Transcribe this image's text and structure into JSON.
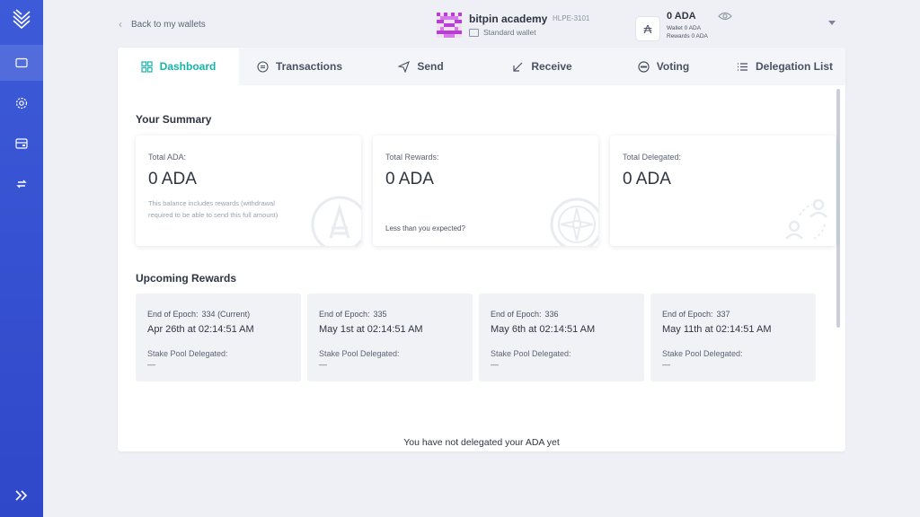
{
  "sidebar": {
    "items": [
      {
        "icon": "wallet-icon",
        "active": true
      },
      {
        "icon": "gear-icon",
        "active": false
      },
      {
        "icon": "hardware-wallet-icon",
        "active": false
      },
      {
        "icon": "exchange-icon",
        "active": false
      }
    ],
    "expand_icon": "double-chevron-right-icon"
  },
  "header": {
    "back_label": "Back to my wallets",
    "wallet_name": "bitpin academy",
    "wallet_ticker": "HLPE-3101",
    "wallet_type": "Standard wallet",
    "balance": "0 ADA",
    "wallet_line": "Wallet 0 ADA",
    "rewards_line": "Rewards 0 ADA"
  },
  "tabs": [
    {
      "label": "Dashboard",
      "icon": "dashboard-icon",
      "active": true
    },
    {
      "label": "Transactions",
      "icon": "transactions-icon",
      "active": false
    },
    {
      "label": "Send",
      "icon": "send-icon",
      "active": false
    },
    {
      "label": "Receive",
      "icon": "receive-icon",
      "active": false
    },
    {
      "label": "Voting",
      "icon": "voting-icon",
      "active": false
    },
    {
      "label": "Delegation List",
      "icon": "list-icon",
      "active": false
    }
  ],
  "summary": {
    "title": "Your Summary",
    "cards": [
      {
        "label": "Total ADA:",
        "value": "0 ADA",
        "note": "This balance includes rewards (withdrawal required to be able to send this full amount)"
      },
      {
        "label": "Total Rewards:",
        "value": "0 ADA",
        "link": "Less than you expected?"
      },
      {
        "label": "Total Delegated:",
        "value": "0 ADA"
      }
    ]
  },
  "rewards": {
    "title": "Upcoming Rewards",
    "epoch_label": "End of Epoch:",
    "pool_label": "Stake Pool Delegated:",
    "cards": [
      {
        "epoch": "334 (Current)",
        "date": "Apr 26th at 02:14:51 AM",
        "pool": "—"
      },
      {
        "epoch": "335",
        "date": "May 1st at 02:14:51 AM",
        "pool": "—"
      },
      {
        "epoch": "336",
        "date": "May 6th at 02:14:51 AM",
        "pool": "—"
      },
      {
        "epoch": "337",
        "date": "May 11th at 02:14:51 AM",
        "pool": "—"
      }
    ]
  },
  "empty_message": "You have not delegated your ADA yet",
  "colors": {
    "sidebar": "#3d5bd9",
    "accent": "#17b4a8",
    "background": "#eef0f5"
  }
}
